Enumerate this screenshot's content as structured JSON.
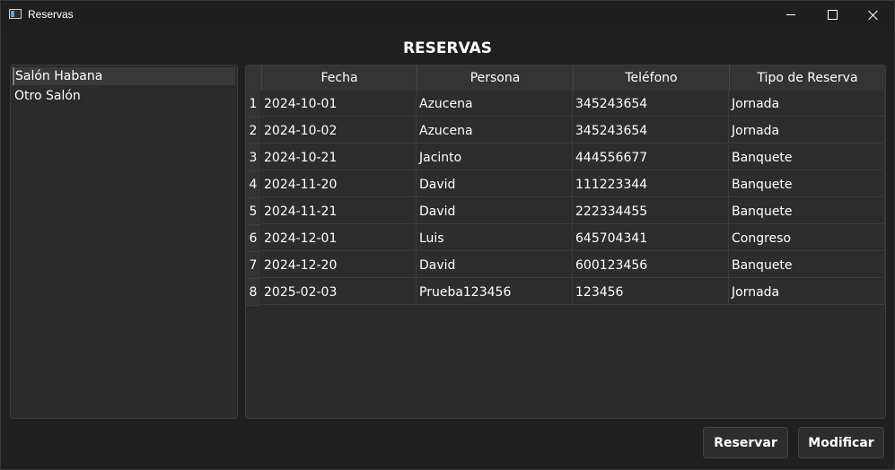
{
  "window": {
    "title": "Reservas"
  },
  "header": {
    "title": "RESERVAS"
  },
  "salones": [
    {
      "label": "Salón Habana",
      "selected": true
    },
    {
      "label": "Otro Salón",
      "selected": false
    }
  ],
  "table": {
    "columns": [
      "Fecha",
      "Persona",
      "Teléfono",
      "Tipo de Reserva"
    ],
    "rows": [
      {
        "n": "1",
        "fecha": "2024-10-01",
        "persona": "Azucena",
        "telefono": "345243654",
        "tipo": "Jornada"
      },
      {
        "n": "2",
        "fecha": "2024-10-02",
        "persona": "Azucena",
        "telefono": "345243654",
        "tipo": "Jornada"
      },
      {
        "n": "3",
        "fecha": "2024-10-21",
        "persona": "Jacinto",
        "telefono": "444556677",
        "tipo": "Banquete"
      },
      {
        "n": "4",
        "fecha": "2024-11-20",
        "persona": "David",
        "telefono": "111223344",
        "tipo": "Banquete"
      },
      {
        "n": "5",
        "fecha": "2024-11-21",
        "persona": "David",
        "telefono": "222334455",
        "tipo": "Banquete"
      },
      {
        "n": "6",
        "fecha": "2024-12-01",
        "persona": "Luis",
        "telefono": "645704341",
        "tipo": "Congreso"
      },
      {
        "n": "7",
        "fecha": "2024-12-20",
        "persona": "David",
        "telefono": "600123456",
        "tipo": "Banquete"
      },
      {
        "n": "8",
        "fecha": "2025-02-03",
        "persona": "Prueba123456",
        "telefono": "123456",
        "tipo": "Jornada"
      }
    ]
  },
  "actions": {
    "reservar": "Reservar",
    "modificar": "Modificar"
  }
}
